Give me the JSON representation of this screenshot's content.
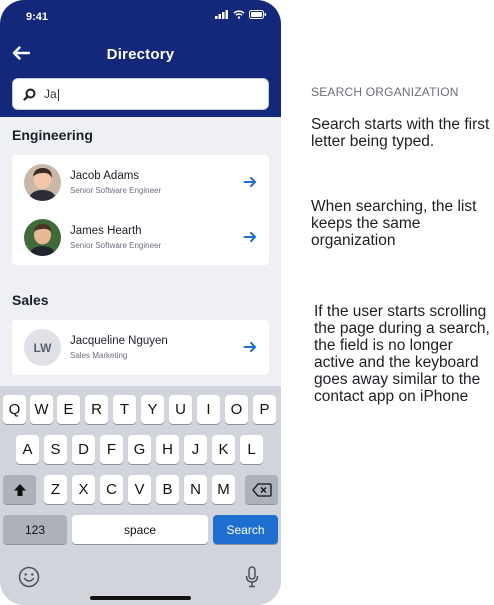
{
  "status": {
    "time": "9:41"
  },
  "header": {
    "title": "Directory"
  },
  "search": {
    "value": "Ja"
  },
  "sections": [
    {
      "title": "Engineering",
      "people": [
        {
          "name": "Jacob Adams",
          "role": "Senior Software Engineer"
        },
        {
          "name": "James Hearth",
          "role": "Senior Software Engineer"
        }
      ]
    },
    {
      "title": "Sales",
      "people": [
        {
          "name": "Jacqueline Nguyen",
          "role": "Sales Marketing",
          "initials": "LW"
        }
      ]
    }
  ],
  "keyboard": {
    "row1": [
      "Q",
      "W",
      "E",
      "R",
      "T",
      "Y",
      "U",
      "I",
      "O",
      "P"
    ],
    "row2": [
      "A",
      "S",
      "D",
      "F",
      "G",
      "H",
      "J",
      "K",
      "L"
    ],
    "row3": [
      "Z",
      "X",
      "C",
      "V",
      "B",
      "N",
      "M"
    ],
    "numbers_label": "123",
    "space_label": "space",
    "search_label": "Search"
  },
  "notes": {
    "heading": "SEARCH ORGANIZATION",
    "note1": "Search starts with the first letter being typed.",
    "note2": "When searching, the list keeps the same organization",
    "note3": "If the user starts scrolling the page during a search, the field is no longer active and the keyboard goes away similar to the contact app on iPhone"
  },
  "colors": {
    "header": "#13287a",
    "accent": "#1f6fd1"
  }
}
